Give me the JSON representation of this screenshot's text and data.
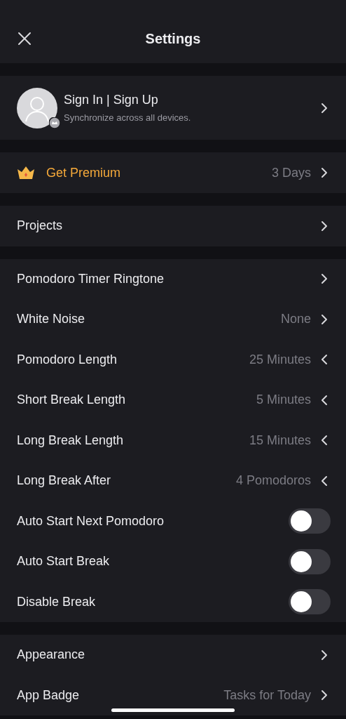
{
  "header": {
    "title": "Settings"
  },
  "account": {
    "title": "Sign In | Sign Up",
    "subtitle": "Synchronize across all devices."
  },
  "premium": {
    "label": "Get Premium",
    "value": "3 Days"
  },
  "groups": [
    {
      "rows": [
        {
          "kind": "nav",
          "label": "Projects"
        }
      ]
    },
    {
      "rows": [
        {
          "kind": "nav",
          "label": "Pomodoro Timer Ringtone"
        },
        {
          "kind": "nav",
          "label": "White Noise",
          "value": "None"
        },
        {
          "kind": "picker",
          "label": "Pomodoro Length",
          "value": "25 Minutes"
        },
        {
          "kind": "picker",
          "label": "Short Break Length",
          "value": "5 Minutes"
        },
        {
          "kind": "picker",
          "label": "Long Break Length",
          "value": "15 Minutes"
        },
        {
          "kind": "picker",
          "label": "Long Break After",
          "value": "4 Pomodoros"
        },
        {
          "kind": "toggle",
          "label": "Auto Start Next Pomodoro",
          "on": false
        },
        {
          "kind": "toggle",
          "label": "Auto Start Break",
          "on": false
        },
        {
          "kind": "toggle",
          "label": "Disable Break",
          "on": false
        }
      ]
    },
    {
      "rows": [
        {
          "kind": "nav",
          "label": "Appearance"
        },
        {
          "kind": "nav",
          "label": "App Badge",
          "value": "Tasks for Today"
        }
      ]
    }
  ]
}
